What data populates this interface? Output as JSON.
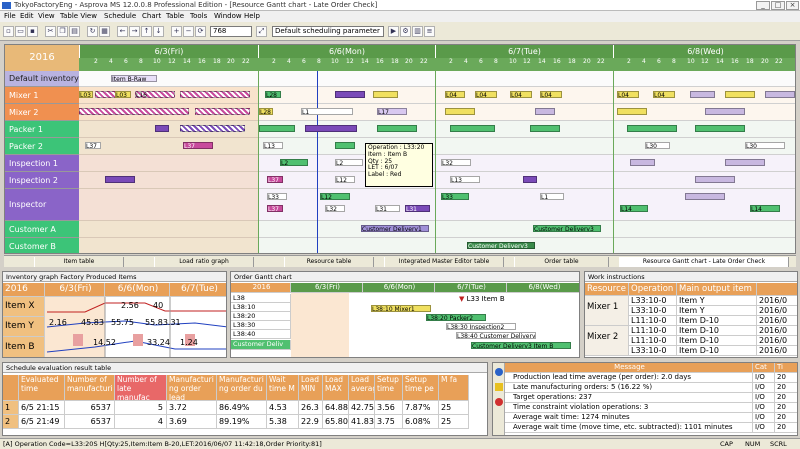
{
  "window": {
    "title": "TokyoFactoryEng - Asprova MS 12.0.0.8 Professional Edition - [Resource Gantt chart - Late Order Check]",
    "min": "_",
    "max": "□",
    "close": "×"
  },
  "menu": [
    "File",
    "Edit",
    "View",
    "Table View",
    "Schedule",
    "Chart",
    "Table",
    "Tools",
    "Window",
    "Help"
  ],
  "toolbar": {
    "zoom": "768",
    "parameter": "Default scheduling parameter"
  },
  "gantt": {
    "year": "2016",
    "days": [
      "6/3(Fri)",
      "6/6(Mon)",
      "6/7(Tue)",
      "6/8(Wed)"
    ],
    "hours": [
      "2",
      "4",
      "6",
      "8",
      "10",
      "12",
      "14",
      "16",
      "18",
      "20",
      "22"
    ],
    "resources": [
      "Default inventory",
      "Mixer 1",
      "Mixer 2",
      "Packer 1",
      "Packer 2",
      "Inspection 1",
      "Inspection 2",
      "Inspector",
      "Customer A",
      "Customer B"
    ],
    "row0_item": "Item B-Raw",
    "m1": [
      "L03",
      "L03",
      "L16",
      "L28",
      "L04",
      "L04",
      "L04",
      "L04",
      "L04",
      "L04"
    ],
    "m2": [
      "L28",
      "L1",
      "L17"
    ],
    "pk2": [
      "L37",
      "L37",
      "L13",
      "L30",
      "L30"
    ],
    "ins1": [
      "L2",
      "L2",
      "L32"
    ],
    "ins2": [
      "L37",
      "L12",
      "L13"
    ],
    "insp": [
      "L33",
      "L37",
      "L12",
      "L32",
      "L31",
      "L31",
      "L33",
      "L1",
      "L14",
      "L14"
    ],
    "cust": [
      "Customer Delivery1",
      "Customer Delivery3",
      "Customer Delivery3"
    ]
  },
  "tooltip": {
    "operation": "Operation  : L33:20",
    "item": "Item  : Item B",
    "qty": "Qty  : 25",
    "let": "LET  : 6/07",
    "label": "Label  : Red"
  },
  "tabs": [
    "Item table",
    "Load ratio graph",
    "Resource table",
    "Integrated Master Editor table",
    "Order table",
    "Resource Gantt chart - Late Order Check"
  ],
  "inventory": {
    "title": "Inventory graph  Factory Produced Items",
    "year": "2016",
    "days": [
      "6/3(Fri)",
      "6/6(Mon)",
      "6/7(Tue)"
    ],
    "rows": [
      {
        "name": "Item X",
        "vals": [
          "",
          "2.56",
          "40",
          ""
        ]
      },
      {
        "name": "Item Y",
        "vals": [
          "2.16",
          "45.83",
          "55.75",
          "55.83.31"
        ]
      },
      {
        "name": "Item B",
        "vals": [
          "",
          "14.52",
          "",
          "33.24",
          "1.24"
        ]
      }
    ]
  },
  "ordergantt": {
    "title": "Order Gantt chart",
    "year": "2016",
    "days": [
      "6/3(Fri)",
      "6/6(Mon)",
      "6/7(Tue)",
      "6/8(Wed)"
    ],
    "rows": [
      "L38",
      "L38:10",
      "L38:20",
      "L38:30",
      "L38:40",
      "Customer Deliv"
    ],
    "labels": [
      "L33 Item B",
      "L38:10 Mixer1",
      "L38:20 Packer2",
      "L38:30 Inspection2",
      "L38:40 Customer Delivery2",
      "Customer Delivery3 Item B"
    ]
  },
  "work": {
    "title": "Work instructions",
    "headers": [
      "Resource",
      "Operation",
      "Main output item",
      ""
    ],
    "rows": [
      {
        "res": "Mixer 1",
        "ops": [
          "L33:10-0",
          "L33:10-0",
          "L11:10-0"
        ],
        "items": [
          "Item Y",
          "Item Y",
          "Item D-10"
        ],
        "dates": [
          "2016/0",
          "2016/0",
          "2016/0"
        ]
      },
      {
        "res": "Mixer 2",
        "ops": [
          "L11:10-0",
          "L11:10-0",
          "L33:10-0"
        ],
        "items": [
          "Item D-10",
          "Item D-10",
          "Item D-10"
        ],
        "dates": [
          "2016/0",
          "2016/0",
          "2016/0"
        ]
      }
    ]
  },
  "evaluation": {
    "title": "Schedule evaluation result table",
    "headers": [
      "Evaluated time",
      "Number of manufacturi",
      "Number of late manufac",
      "Manufacturi ng order lead",
      "Manufacturi ng order du",
      "Wait time M",
      "Load MIN",
      "Load MAX",
      "Load average",
      "Setup time",
      "Setup time pe",
      "M fa"
    ],
    "rows": [
      {
        "n": "1",
        "vals": [
          "6/5 21:15",
          "6537",
          "5",
          "3.72",
          "86.49%",
          "4.53",
          "26.3",
          "64.88",
          "42.75",
          "3.56",
          "7.87%",
          "25"
        ]
      },
      {
        "n": "2",
        "vals": [
          "6/5 21:49",
          "6537",
          "4",
          "3.69",
          "89.19%",
          "5.38",
          "22.9",
          "65.80",
          "41.83",
          "3.75",
          "6.08%",
          "25"
        ]
      }
    ]
  },
  "messages": {
    "headers": [
      "Message",
      "Cat",
      "Ti"
    ],
    "rows": [
      {
        "text": "Production lead time average (per order): 2.0 days",
        "cat": "I/O",
        "ti": "20"
      },
      {
        "text": "Late manufacturing orders: 5 (16.22 %)",
        "cat": "I/O",
        "ti": "20"
      },
      {
        "text": "Target operations: 237",
        "cat": "I/O",
        "ti": "20"
      },
      {
        "text": "Time constraint violation operations: 3",
        "cat": "I/O",
        "ti": "20"
      },
      {
        "text": "Average wait time: 1274 minutes",
        "cat": "I/O",
        "ti": "20"
      },
      {
        "text": "Average wait time (move time, etc. subtracted): 1101 minutes",
        "cat": "I/O",
        "ti": "20"
      }
    ]
  },
  "status": {
    "left": "[A] Operation Code=L33:20S  H[Qty:25,Item:Item B-20,LET:2016/06/07 11:42:18,Order Priority:81]",
    "r1": "CAP",
    "r2": "NUM",
    "r3": "SCRL"
  },
  "colors": {
    "accent": "#5a9a4a",
    "orange": "#e8a058",
    "mixer": "#f0e060",
    "purple": "#7a4ab8",
    "green": "#38b870"
  }
}
